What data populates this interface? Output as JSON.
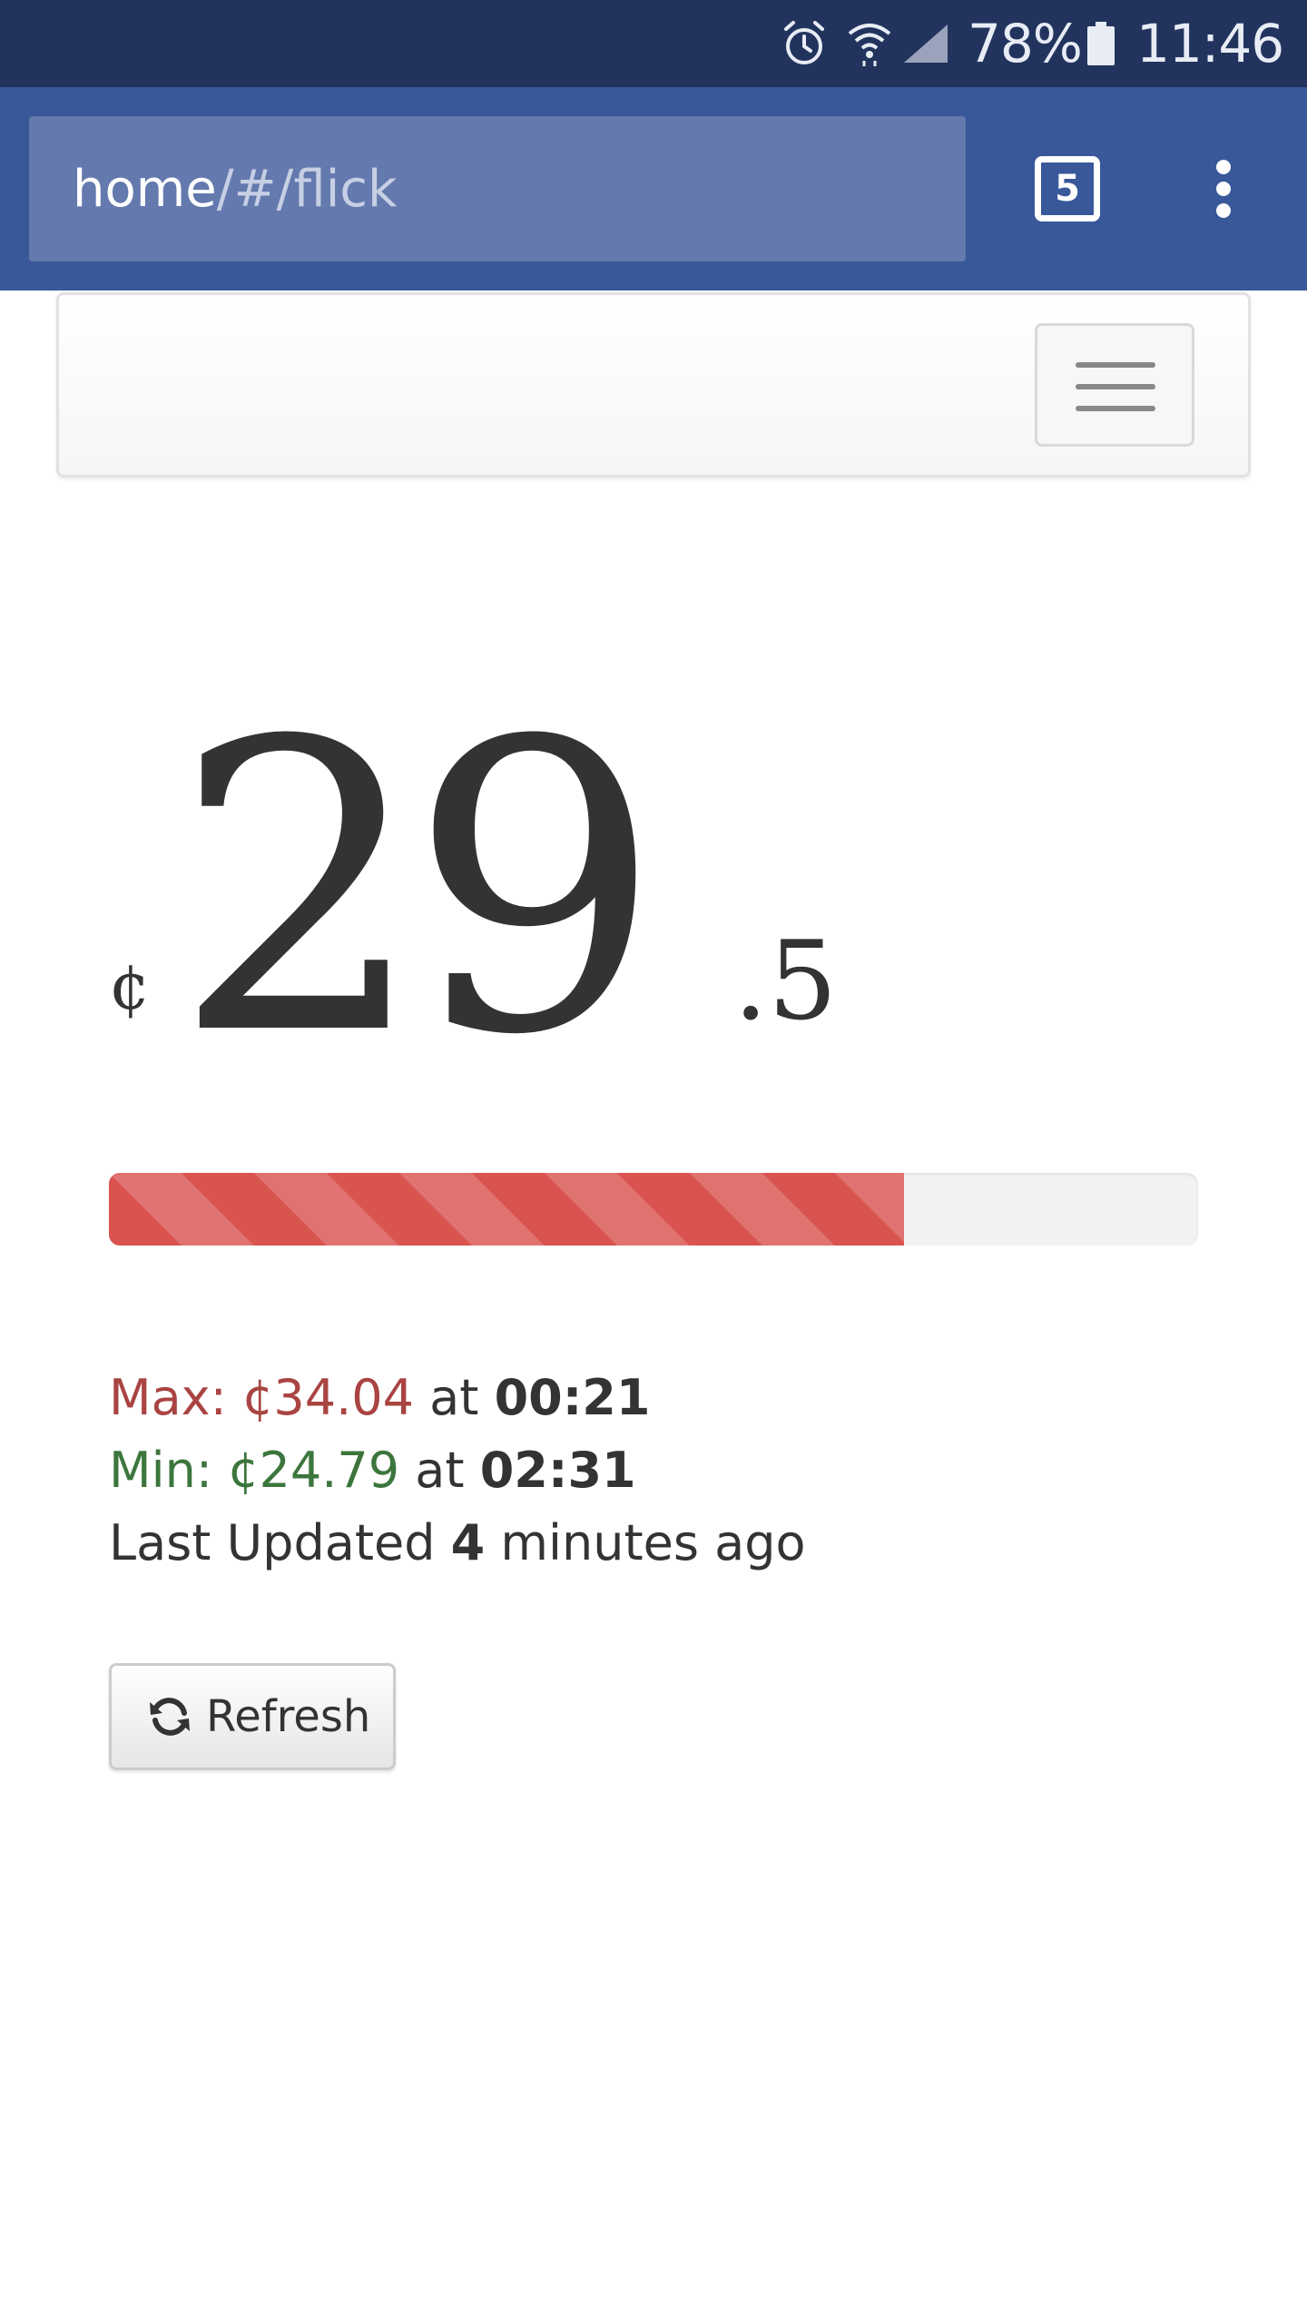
{
  "status_bar": {
    "battery_percent": "78%",
    "time": "11:46",
    "icons": [
      "alarm-icon",
      "wifi-icon",
      "signal-icon",
      "battery-icon"
    ]
  },
  "browser": {
    "url_host": "home",
    "url_path": "/#/flick",
    "tab_count": "5"
  },
  "price": {
    "currency_symbol": "¢",
    "integer_part": "29",
    "decimal_part": ".5"
  },
  "progress": {
    "percent": 73,
    "color": "#d9534f"
  },
  "stats": {
    "max_label": "Max: ¢34.04",
    "max_at": "at",
    "max_time": "00:21",
    "min_label": "Min: ¢24.79",
    "min_at": "at",
    "min_time": "02:31",
    "updated_prefix": "Last Updated",
    "updated_value": "4",
    "updated_suffix": "minutes ago"
  },
  "refresh_button": {
    "label": "Refresh",
    "icon": "refresh-icon"
  },
  "colors": {
    "status_bar": "#22345e",
    "toolbar": "#38589a",
    "max": "#a94442",
    "min": "#3c763d"
  }
}
